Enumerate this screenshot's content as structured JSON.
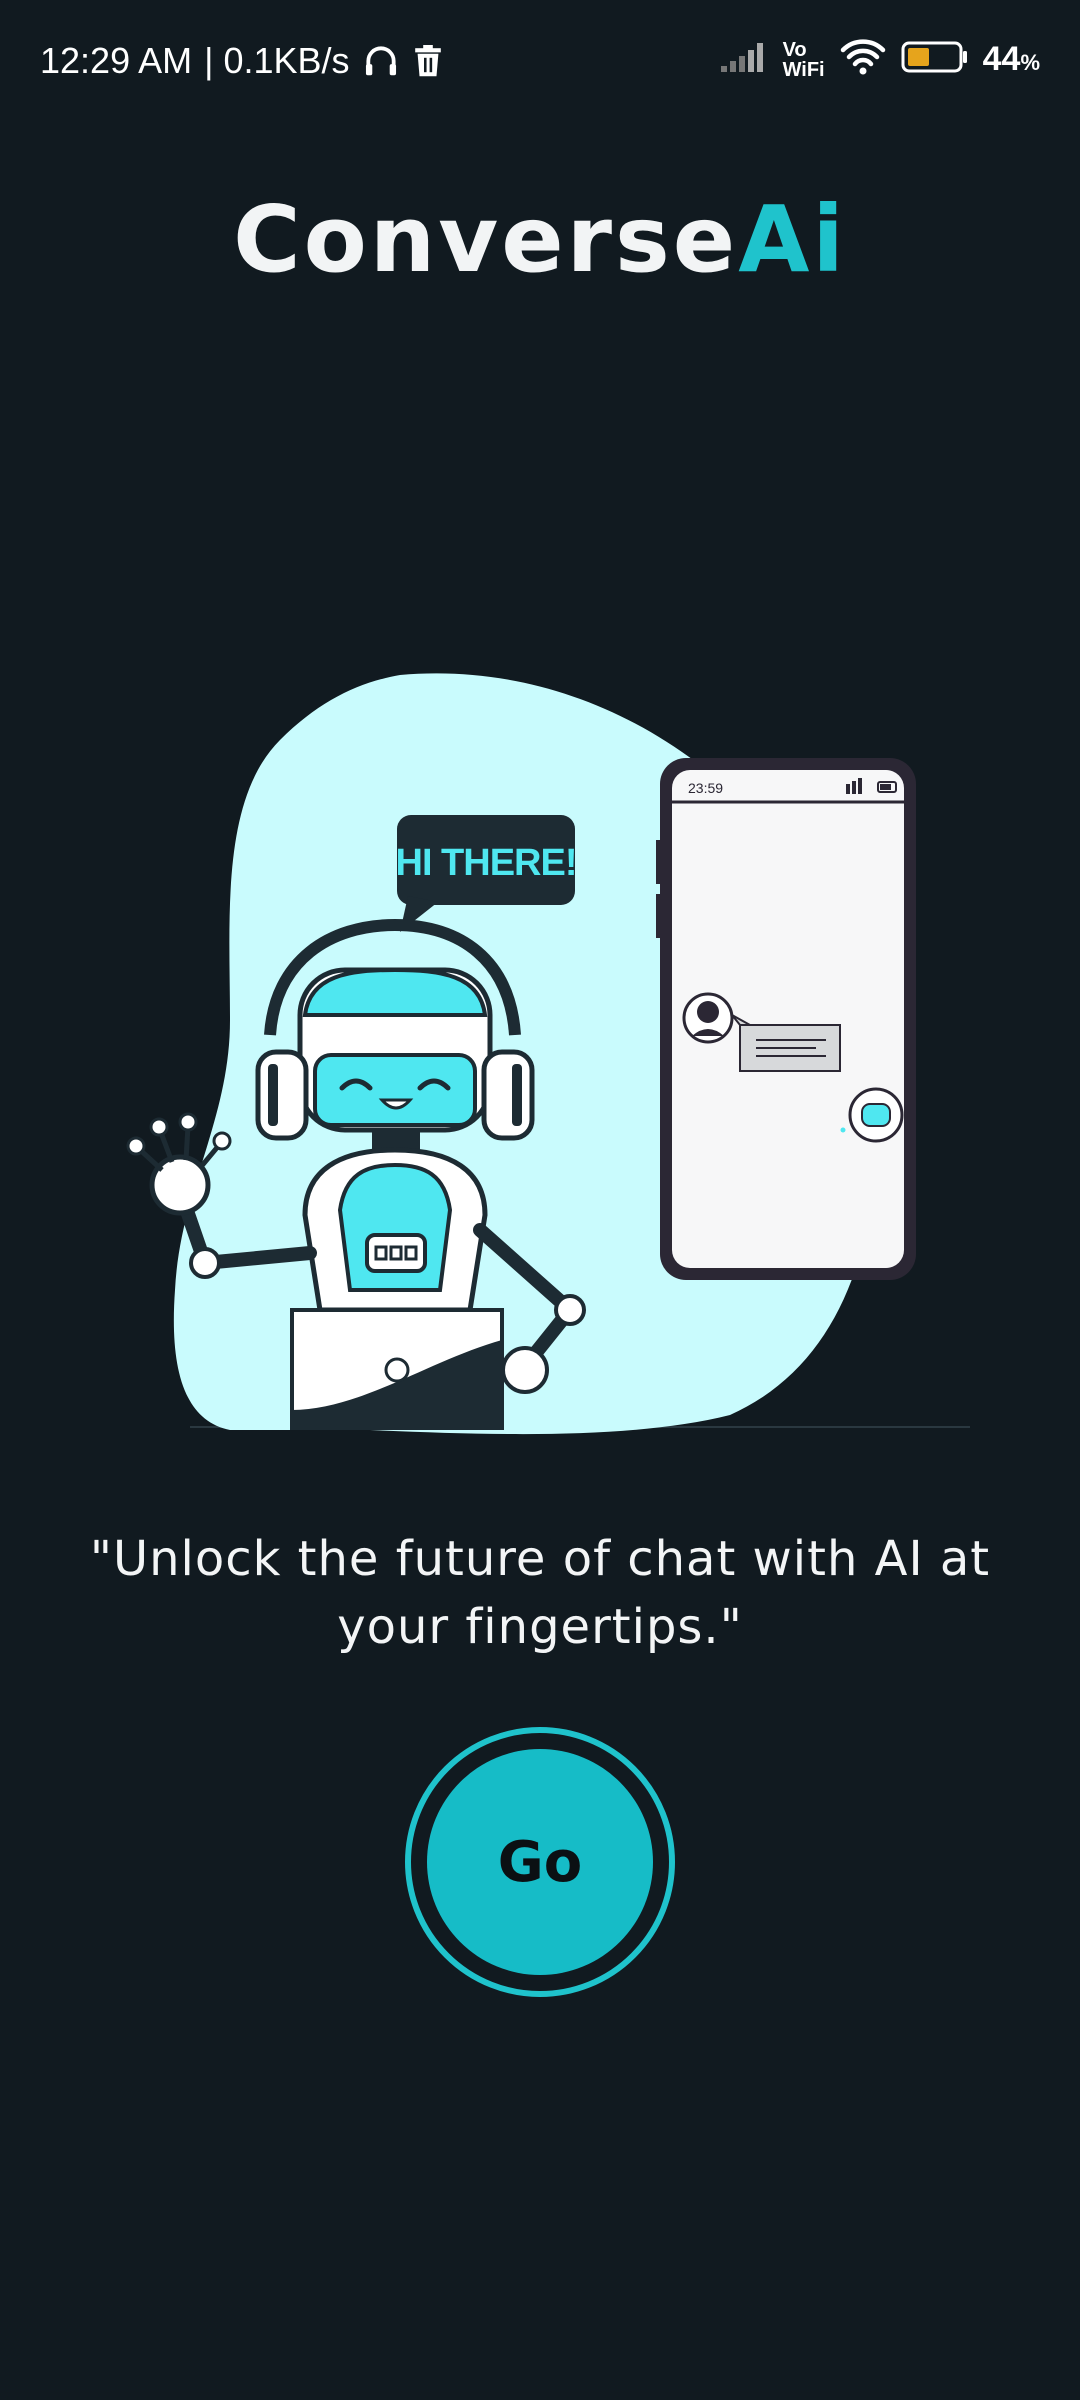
{
  "status_bar": {
    "time": "12:29 AM",
    "speed": "| 0.1KB/s",
    "vo_label": "Vo",
    "wifi_label": "WiFi",
    "battery_value": "44",
    "battery_unit": "%",
    "battery_level": 0.44,
    "icons": [
      "headphones-icon",
      "trash-icon",
      "signal-icon",
      "vowifi-icon",
      "wifi-icon",
      "battery-icon"
    ]
  },
  "app": {
    "title_part1": "Converse",
    "title_part2": "Ai"
  },
  "illustration": {
    "speech_text": "HI THERE!",
    "phone_time": "23:59"
  },
  "tagline": "\"Unlock the future of chat with AI at your fingertips.\"",
  "go_button": {
    "label": "Go"
  },
  "colors": {
    "background": "#111a20",
    "accent": "#1fc3cc",
    "blob": "#c9fbfd",
    "robot_cyan": "#4fe7f0"
  }
}
